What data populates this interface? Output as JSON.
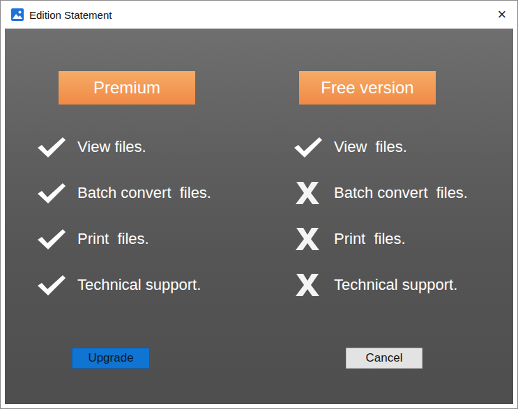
{
  "window": {
    "title": "Edition Statement",
    "close": "×"
  },
  "editions": [
    {
      "name": "Premium",
      "features": [
        {
          "label": "View files.",
          "included": true
        },
        {
          "label": "Batch convert  files.",
          "included": true
        },
        {
          "label": "Print  files.",
          "included": true
        },
        {
          "label": "Technical support.",
          "included": true
        }
      ]
    },
    {
      "name": "Free version",
      "features": [
        {
          "label": "View  files.",
          "included": true
        },
        {
          "label": "Batch convert  files.",
          "included": false
        },
        {
          "label": "Print  files.",
          "included": false
        },
        {
          "label": "Technical support.",
          "included": false
        }
      ]
    }
  ],
  "buttons": [
    {
      "label": "Upgrade",
      "kind": "primary"
    },
    {
      "label": "Cancel",
      "kind": "secondary"
    }
  ]
}
